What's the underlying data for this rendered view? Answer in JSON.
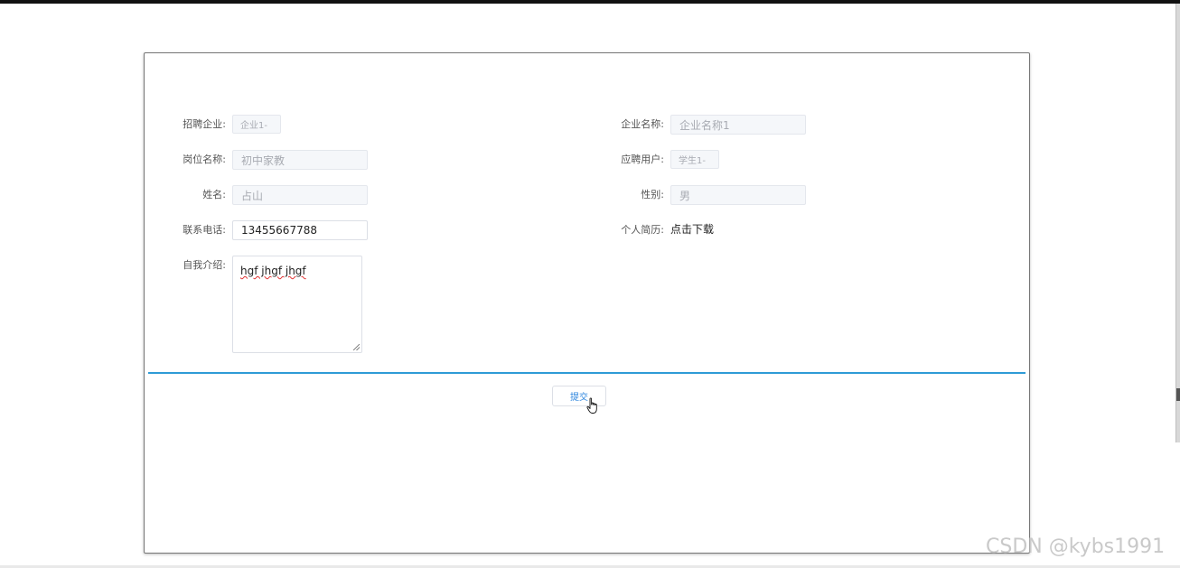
{
  "form": {
    "left": {
      "company": {
        "label": "招聘企业:",
        "value": "企业1-"
      },
      "position": {
        "label": "岗位名称:",
        "value": "初中家教"
      },
      "name": {
        "label": "姓名:",
        "value": "占山"
      },
      "phone": {
        "label": "联系电话:",
        "value": "13455667788"
      },
      "intro": {
        "label": "自我介绍:",
        "value": "hgf jhgf jhgf"
      }
    },
    "right": {
      "company_name": {
        "label": "企业名称:",
        "value": "企业名称1"
      },
      "applicant": {
        "label": "应聘用户:",
        "value": "学生1-"
      },
      "gender": {
        "label": "性别:",
        "value": "男"
      },
      "resume": {
        "label": "个人简历:",
        "link": "点击下载"
      }
    },
    "submit_label": "提交"
  },
  "watermark": "CSDN @kybs1991",
  "colors": {
    "accent": "#2e9bd6",
    "button_text": "#2e86de"
  }
}
